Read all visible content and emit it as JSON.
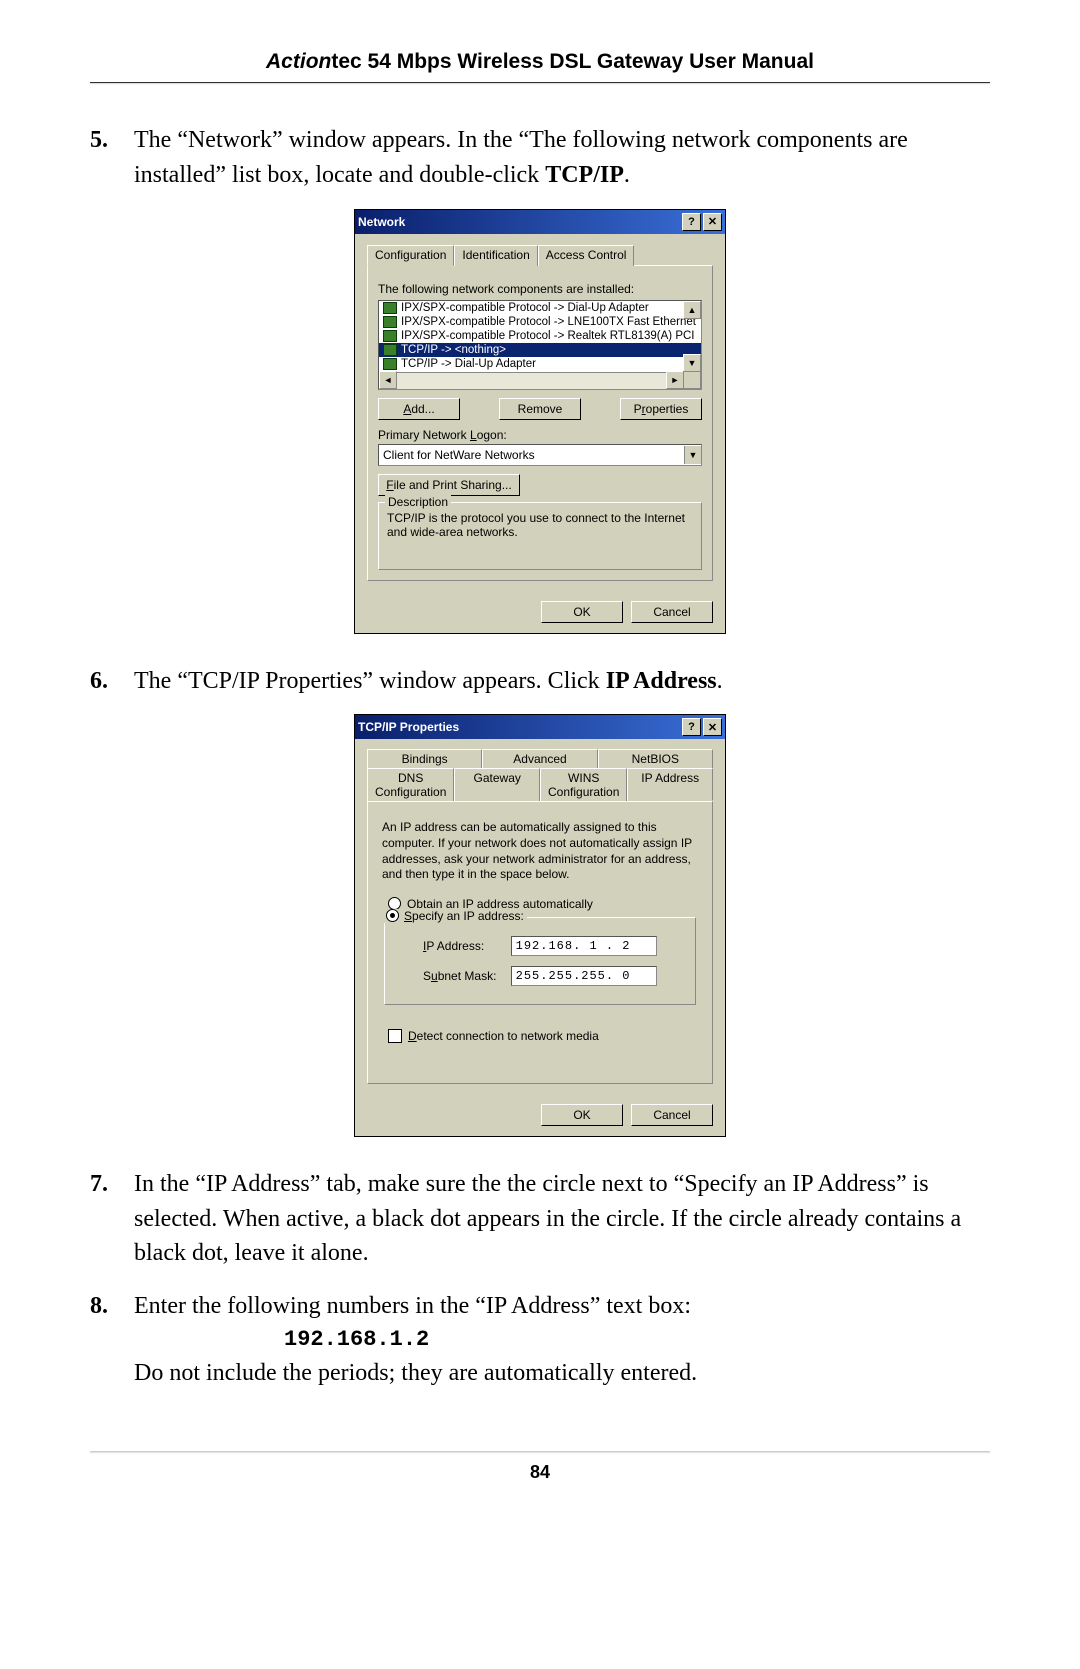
{
  "header": {
    "brand_italic": "Action",
    "brand_rest": "tec 54 Mbps Wireless DSL Gateway User Manual"
  },
  "step5": {
    "num": "5.",
    "text_a": "The “Network” window appears. In the “The following network components are installed” list box, locate and double-click ",
    "bold": "TCP/IP",
    "period": "."
  },
  "network_dialog": {
    "title": "Network",
    "tabs": {
      "config": "Configuration",
      "ident": "Identification",
      "access": "Access Control"
    },
    "components_label": "The following network components are installed:",
    "items": [
      "IPX/SPX-compatible Protocol -> Dial-Up Adapter",
      "IPX/SPX-compatible Protocol -> LNE100TX Fast Ethernet",
      "IPX/SPX-compatible Protocol -> Realtek RTL8139(A) PCI",
      "TCP/IP -> <nothing>",
      "TCP/IP -> Dial-Up Adapter"
    ],
    "add": "Add...",
    "remove": "Remove",
    "properties": "Properties",
    "logon_label": "Primary Network Logon:",
    "logon_value": "Client for NetWare Networks",
    "fileshare": "File and Print Sharing...",
    "desc_title": "Description",
    "desc_text": "TCP/IP is the protocol you use to connect to the Internet and wide-area networks.",
    "ok": "OK",
    "cancel": "Cancel"
  },
  "step6": {
    "num": "6.",
    "text_a": "The “TCP/IP Properties” window appears. Click ",
    "bold": "IP Address",
    "period": "."
  },
  "tcpip_dialog": {
    "title": "TCP/IP Properties",
    "tabs_upper": {
      "bindings": "Bindings",
      "advanced": "Advanced",
      "netbios": "NetBIOS"
    },
    "tabs_lower": {
      "dns": "DNS Configuration",
      "gateway": "Gateway",
      "wins": "WINS Configuration",
      "ip": "IP Address"
    },
    "para": "An IP address can be automatically assigned to this computer. If your network does not automatically assign IP addresses, ask your network administrator for an address, and then type it in the space below.",
    "radio_obtain": "Obtain an IP address automatically",
    "radio_specify": "Specify an IP address:",
    "ip_label": "IP Address:",
    "ip_value": "192.168. 1 . 2",
    "mask_label": "Subnet Mask:",
    "mask_value": "255.255.255. 0",
    "detect": "Detect connection to network media",
    "ok": "OK",
    "cancel": "Cancel"
  },
  "step7": {
    "num": "7.",
    "text": "In the “IP Address” tab, make sure the the circle next to “Specify an IP Address” is selected. When active, a black dot appears in the circle. If the circle already contains a black dot, leave it alone."
  },
  "step8": {
    "num": "8.",
    "text_a": "Enter the following numbers in the “IP Address” text box:",
    "code": "192.168.1.2",
    "text_b": "Do not include the periods; they are automatically entered."
  },
  "page_number": "84"
}
